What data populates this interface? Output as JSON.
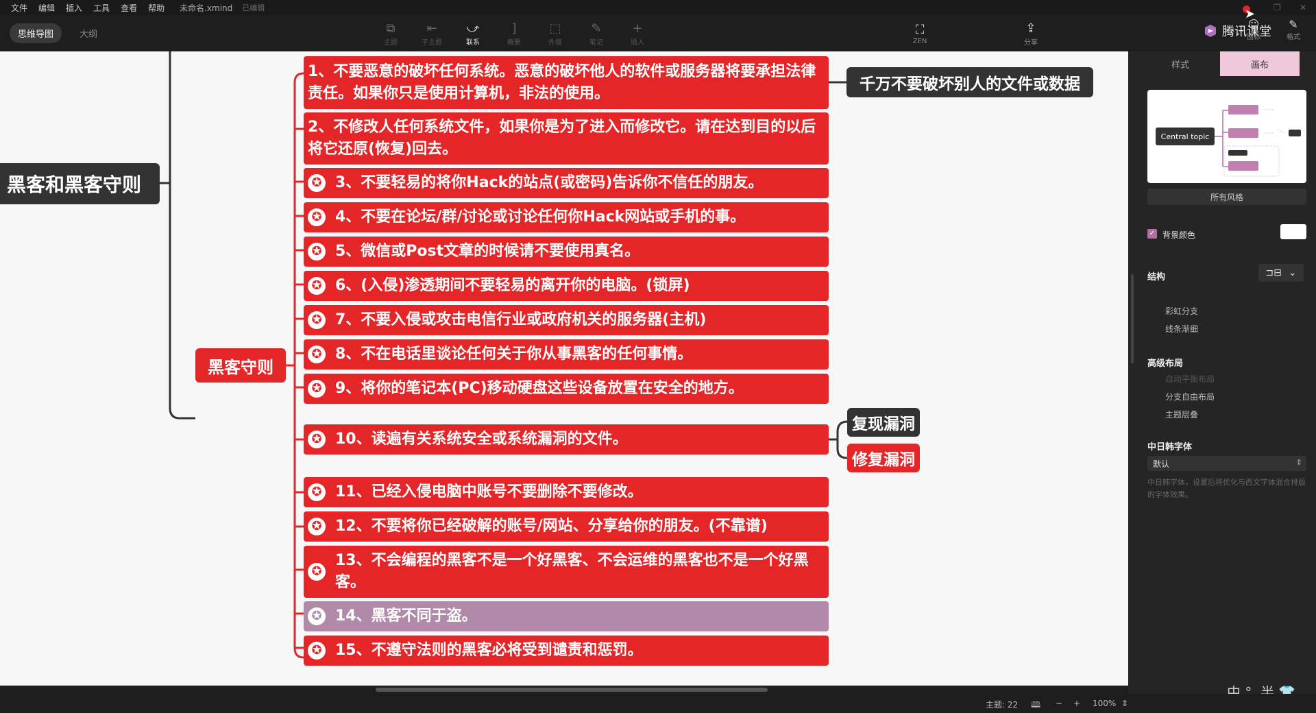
{
  "menu": [
    "文件",
    "编辑",
    "插入",
    "工具",
    "查看",
    "帮助"
  ],
  "file_name": "未命名.xmind",
  "save_status": "已编辑",
  "view_tabs": [
    "思维导图",
    "大纲"
  ],
  "toolbar": {
    "tools": [
      {
        "icon": "topic-icon",
        "glyph": "⧉",
        "label": "主题"
      },
      {
        "icon": "subtopic-icon",
        "glyph": "⇤",
        "label": "子主题"
      },
      {
        "icon": "relationship-icon",
        "glyph": "⤻",
        "label": "联系"
      },
      {
        "icon": "summary-icon",
        "glyph": "]",
        "label": "概要"
      },
      {
        "icon": "boundary-icon",
        "glyph": "⬚",
        "label": "外框"
      },
      {
        "icon": "note-icon",
        "glyph": "✎",
        "label": "笔记"
      },
      {
        "icon": "insert-icon",
        "glyph": "+",
        "label": "插入"
      }
    ],
    "zen_label": "ZEN",
    "share_label": "分享"
  },
  "brand": "腾讯课堂",
  "right_tools": [
    {
      "label": "图标"
    },
    {
      "label": "格式"
    }
  ],
  "mindmap": {
    "root": "黑客和黑客守则",
    "sub": "黑客守则",
    "rules": [
      {
        "text": "1、不要恶意的破坏任何系统。恶意的破坏他人的软件或服务器将要承担法律责任。如果你只是使用计算机，非法的使用。",
        "star": false
      },
      {
        "text": "2、不修改人任何系统文件，如果你是为了进入而修改它。请在达到目的以后将它还原(恢复)回去。",
        "star": false
      },
      {
        "text": "3、不要轻易的将你Hack的站点(或密码)告诉你不信任的朋友。",
        "star": true
      },
      {
        "text": "4、不要在论坛/群/讨论或讨论任何你Hack网站或手机的事。",
        "star": true
      },
      {
        "text": "5、微信或Post文章的时候请不要使用真名。",
        "star": true
      },
      {
        "text": "6、(入侵)渗透期间不要轻易的离开你的电脑。(锁屏)",
        "star": true
      },
      {
        "text": "7、不要入侵或攻击电信行业或政府机关的服务器(主机)",
        "star": true
      },
      {
        "text": "8、不在电话里谈论任何关于你从事黑客的任何事情。",
        "star": true
      },
      {
        "text": "9、将你的笔记本(PC)移动硬盘这些设备放置在安全的地方。",
        "star": true
      },
      {
        "text": "10、读遍有关系统安全或系统漏洞的文件。",
        "star": true
      },
      {
        "text": "11、已经入侵电脑中账号不要删除不要修改。",
        "star": true
      },
      {
        "text": "12、不要将你已经破解的账号/网站、分享给你的朋友。(不靠谱)",
        "star": true
      },
      {
        "text": "13、不会编程的黑客不是一个好黑客、不会运维的黑客也不是一个好黑客。",
        "star": true
      },
      {
        "text": "14、黑客不同于盗。",
        "star": true
      },
      {
        "text": "15、不遵守法则的黑客必将受到谴责和惩罚。",
        "star": true
      }
    ],
    "note_1": "千万不要破坏别人的文件或数据",
    "note_10a": "复现漏洞",
    "note_10b": "修复漏洞"
  },
  "panel": {
    "tabs": [
      "样式",
      "画布"
    ],
    "preview_center": "Central topic",
    "all_styles": "所有风格",
    "bg_color": "背景颜色",
    "structure": "结构",
    "rainbow": "彩虹分支",
    "line_taper": "线条渐细",
    "advanced_layout": "高级布局",
    "auto_balance": "自动平衡布局",
    "free_layout": "分支自由布局",
    "topic_overlap": "主题层叠",
    "cjk_font": "中日韩字体",
    "cjk_default": "默认",
    "cjk_hint": "中日韩字体，设置后将优化与西文字体混合排版的字体效果。"
  },
  "status": {
    "topics": "主题: 22",
    "zoom": "100%"
  },
  "ime": "中 °, 半 👕"
}
